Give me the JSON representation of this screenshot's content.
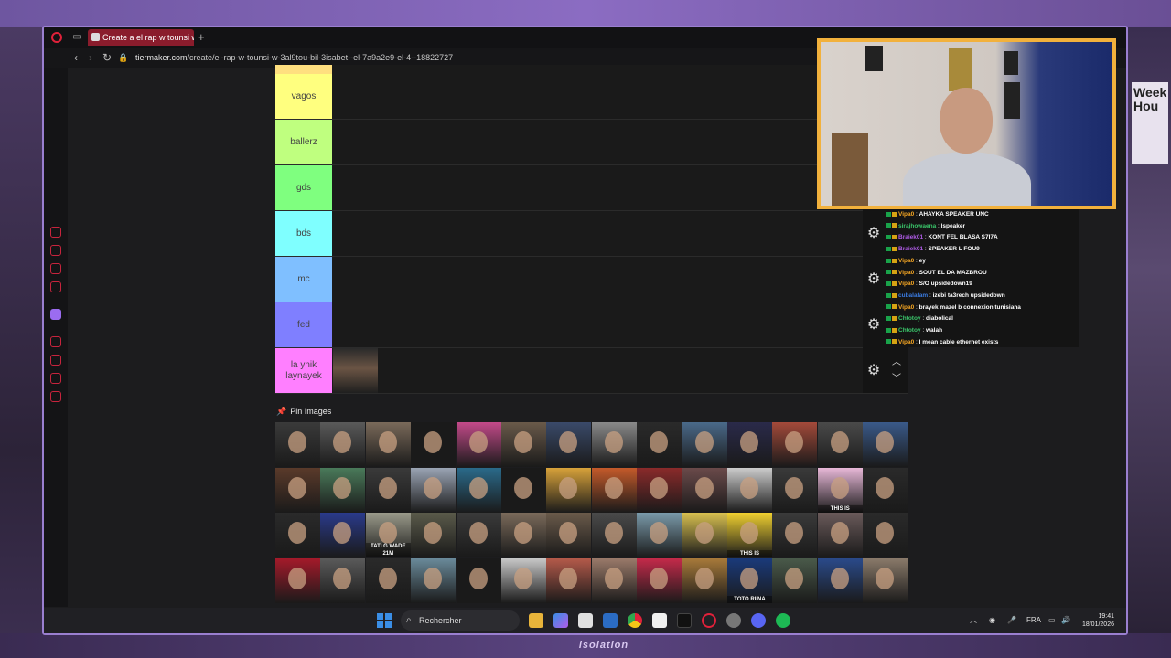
{
  "browser": {
    "tab_title": "Create a el rap w tounsi w",
    "url_host": "tiermaker.com",
    "url_path": "/create/el-rap-w-tounsi-w-3al9tou-bil-3isabet--el-7a9a2e9-el-4--18822727"
  },
  "tiers": [
    {
      "label": "vagos",
      "color": "#ffff7f"
    },
    {
      "label": "ballerz",
      "color": "#bfff7f"
    },
    {
      "label": "gds",
      "color": "#7fff7f"
    },
    {
      "label": "bds",
      "color": "#7fffff"
    },
    {
      "label": "mc",
      "color": "#7fbfff"
    },
    {
      "label": "fed",
      "color": "#7f7fff"
    },
    {
      "label": "la ynik laynayek",
      "color": "#ff7fff"
    }
  ],
  "pin_images": {
    "title": "Pin Images",
    "captions": [
      "TATI G WADE 21M",
      "THIS IS",
      "THIS IS",
      "TOTO RIINA"
    ]
  },
  "chat": [
    {
      "user": "Vipa0",
      "color": "#f5a623",
      "text": "AHAYKA SPEAKER UNC"
    },
    {
      "user": "sirajhowaena",
      "color": "#3ac46a",
      "text": "lspeaker"
    },
    {
      "user": "Braiek01",
      "color": "#b05ce8",
      "text": "KONT FEL BLASA S7I7A"
    },
    {
      "user": "Braiek01",
      "color": "#b05ce8",
      "text": "SPEAKER L FOU9"
    },
    {
      "user": "Vipa0",
      "color": "#f5a623",
      "text": "ey"
    },
    {
      "user": "Vipa0",
      "color": "#f5a623",
      "text": "SOUT EL DA MAZBROU"
    },
    {
      "user": "Vipa0",
      "color": "#f5a623",
      "text": "S/O upsidedown19"
    },
    {
      "user": "cubalafam",
      "color": "#3a7be0",
      "text": "izebi ta3rech upsidedown"
    },
    {
      "user": "Vipa0",
      "color": "#f5a623",
      "text": "brayek mazel b connexion tunisiana"
    },
    {
      "user": "Chtotoy",
      "color": "#3ac46a",
      "text": "diabolical"
    },
    {
      "user": "Chtotoy",
      "color": "#3ac46a",
      "text": "walah"
    },
    {
      "user": "Vipa0",
      "color": "#f5a623",
      "text": "I mean cable ethernet exists"
    }
  ],
  "taskbar": {
    "search_placeholder": "Rechercher",
    "language": "FRA",
    "time": "19:41",
    "date": "18/01/2026"
  },
  "overlay": {
    "brand": "isolation",
    "poster_text": "Week Hou"
  }
}
